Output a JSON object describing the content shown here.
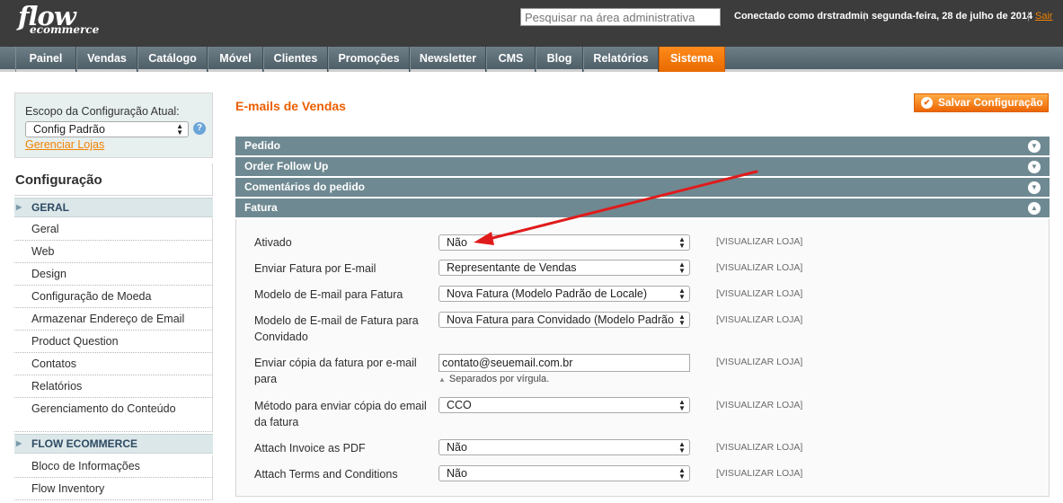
{
  "header": {
    "logo_line1": "flow",
    "logo_line2": "ecommerce",
    "search_placeholder": "Pesquisar na área administrativa",
    "user": "Conectado como drstradmin",
    "separator": "|",
    "date": "segunda-feira, 28 de julho de 2014",
    "logout": "Sair"
  },
  "nav": {
    "tabs": [
      {
        "label": "Painel"
      },
      {
        "label": "Vendas"
      },
      {
        "label": "Catálogo"
      },
      {
        "label": "Móvel"
      },
      {
        "label": "Clientes"
      },
      {
        "label": "Promoções"
      },
      {
        "label": "Newsletter"
      },
      {
        "label": "CMS"
      },
      {
        "label": "Blog"
      },
      {
        "label": "Relatórios"
      },
      {
        "label": "Sistema"
      }
    ],
    "active": "Sistema",
    "active_color": "#f18200"
  },
  "sidebar": {
    "scope_label": "Escopo da Configuração Atual:",
    "scope_value": "Config Padrão",
    "scope_help": "?",
    "manage_stores": "Gerenciar Lojas",
    "title": "Configuração",
    "groups": [
      {
        "label": "GERAL",
        "items": [
          "Geral",
          "Web",
          "Design",
          "Configuração de Moeda",
          "Armazenar Endereço de Email",
          "Product Question",
          "Contatos",
          "Relatórios",
          "Gerenciamento do Conteúdo"
        ]
      },
      {
        "label": "FLOW ECOMMERCE",
        "items": [
          "Bloco de Informações",
          "Flow Inventory"
        ]
      }
    ]
  },
  "main": {
    "title": "E-mails de Vendas",
    "save_button": "Salvar Configuração",
    "sections": [
      "Pedido",
      "Order Follow Up",
      "Comentários do pedido",
      "Fatura"
    ],
    "fields": [
      {
        "label": "Ativado",
        "value": "Não",
        "scope": "[VISUALIZAR LOJA]"
      },
      {
        "label": "Enviar Fatura por E-mail",
        "value": "Representante de Vendas",
        "scope": "[VISUALIZAR LOJA]"
      },
      {
        "label": "Modelo de E-mail para Fatura",
        "value": "Nova Fatura (Modelo Padrão de Locale)",
        "scope": "[VISUALIZAR LOJA]"
      },
      {
        "label": "Modelo de E-mail de Fatura para Convidado",
        "value": "Nova Fatura para Convidado (Modelo Padrão",
        "scope": "[VISUALIZAR LOJA]"
      },
      {
        "label": "Enviar cópia da fatura por e-mail para",
        "value": "contato@seuemail.com.br",
        "note": "Separados por vírgula.",
        "scope": "[VISUALIZAR LOJA]"
      },
      {
        "label": "Método para enviar cópia do email da fatura",
        "value": "CCO",
        "scope": "[VISUALIZAR LOJA]"
      },
      {
        "label": "Attach Invoice as PDF",
        "value": "Não",
        "scope": "[VISUALIZAR LOJA]"
      },
      {
        "label": "Attach Terms and Conditions",
        "value": "Não",
        "scope": "[VISUALIZAR LOJA]"
      }
    ]
  },
  "annotation_color": "#e01b1b"
}
